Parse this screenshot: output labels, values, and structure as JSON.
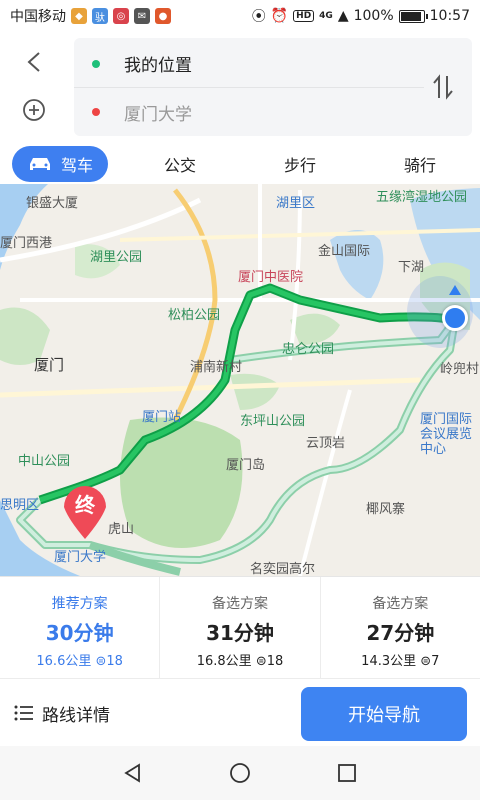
{
  "status_bar": {
    "carrier": "中国移动",
    "battery": "100%",
    "time": "10:57",
    "network": "4G",
    "hd": "HD"
  },
  "route": {
    "origin": "我的位置",
    "destination": "厦门大学"
  },
  "modes": [
    {
      "label": "驾车",
      "active": true
    },
    {
      "label": "公交",
      "active": false
    },
    {
      "label": "步行",
      "active": false
    },
    {
      "label": "骑行",
      "active": false
    }
  ],
  "map_labels": {
    "yinxian": "银盛大厦",
    "huli_district": "湖里区",
    "wuyuanwan": "五缘湾湿地公园",
    "xiamen_xigang": "厦门西港",
    "huli_park": "湖里公园",
    "jinshan": "金山国际",
    "xiadong": "下湖",
    "tcm_hospital": "厦门中医院",
    "songbai_park": "松柏公园",
    "zhonglun_park": "忠仑公园",
    "xiamen": "厦门",
    "punan": "浦南新村",
    "lingdou": "岭兜村",
    "station": "厦门站",
    "dongping_park": "东坪山公园",
    "exhibition": "厦门国际会议展览中心",
    "yundingyan": "云顶岩",
    "zhongshan_park": "中山公园",
    "xiamen_island": "厦门岛",
    "siming": "思明区",
    "hushan": "虎山",
    "yefengzhai": "椰风寨",
    "xmu": "厦门大学",
    "mingyuan": "名奕园高尔"
  },
  "end_marker": "终",
  "plans": [
    {
      "tag": "推荐方案",
      "time": "30分钟",
      "distance": "16.6公里",
      "lights": "18",
      "recommended": true
    },
    {
      "tag": "备选方案",
      "time": "31分钟",
      "distance": "16.8公里",
      "lights": "18",
      "recommended": false
    },
    {
      "tag": "备选方案",
      "time": "27分钟",
      "distance": "14.3公里",
      "lights": "7",
      "recommended": false
    }
  ],
  "actions": {
    "detail": "路线详情",
    "start_nav": "开始导航"
  },
  "colors": {
    "accent": "#3e84f2",
    "route_main": "#1fb85c",
    "route_alt": "#a9dcc2"
  },
  "icons": {
    "back": "chevron-left-icon",
    "add": "plus-circle-icon",
    "swap": "swap-vertical-icon",
    "car": "car-icon",
    "list": "list-icon",
    "traffic_light": "traffic-light-icon"
  }
}
